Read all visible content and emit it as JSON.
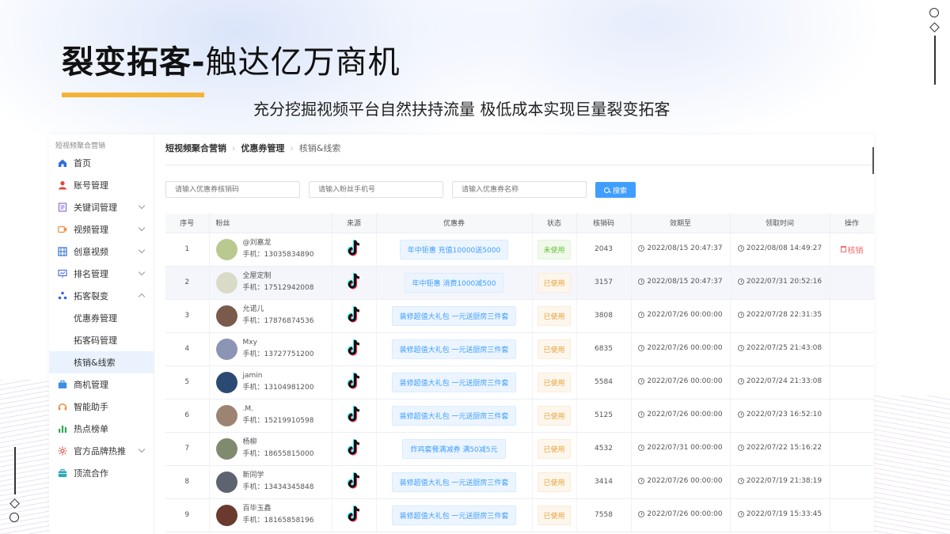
{
  "hero": {
    "title_bold": "裂变拓客-",
    "title_rest": "触达亿万商机",
    "subtitle": "充分挖掘视频平台自然扶持流量 极低成本实现巨量裂变拓客"
  },
  "sidebar": {
    "brand": "短视频聚合营销",
    "items": [
      {
        "label": "首页",
        "icon": "home-icon"
      },
      {
        "label": "账号管理",
        "icon": "user-icon"
      },
      {
        "label": "关键词管理",
        "icon": "keyword-icon"
      },
      {
        "label": "视频管理",
        "icon": "video-icon"
      },
      {
        "label": "创意视频",
        "icon": "film-icon"
      },
      {
        "label": "排名管理",
        "icon": "rank-icon"
      },
      {
        "label": "拓客裂变",
        "icon": "fission-icon"
      },
      {
        "label": "商机管理",
        "icon": "briefcase-icon"
      },
      {
        "label": "智能助手",
        "icon": "headset-icon"
      },
      {
        "label": "热点榜单",
        "icon": "bar-chart-icon"
      },
      {
        "label": "官方品牌热推",
        "icon": "brand-icon"
      },
      {
        "label": "顶流合作",
        "icon": "cooperation-icon"
      }
    ],
    "sub_items": [
      "优惠券管理",
      "拓客码管理",
      "核销&线索"
    ]
  },
  "breadcrumb": [
    "短视频聚合营销",
    "优惠券管理",
    "核销&线索"
  ],
  "filters": {
    "coupon_code_placeholder": "请输入优惠券核销码",
    "fan_phone_placeholder": "请输入粉丝手机号",
    "coupon_name_placeholder": "请输入优惠券名称",
    "search_label": "搜索"
  },
  "table": {
    "columns": [
      "序号",
      "粉丝",
      "来源",
      "优惠券",
      "状态",
      "核销码",
      "效期至",
      "领取时间",
      "操作"
    ],
    "action_label": "核销",
    "rows": [
      {
        "index": "1",
        "name": "@刘嘉龙",
        "phone": "手机：13035834890",
        "coupon": "年中钜惠 充值10000送5000",
        "status": "未使用",
        "code": "2043",
        "valid_until": "2022/08/15 20:47:37",
        "received": "2022/08/08 14:49:27",
        "avatar_color": "#b9c98f"
      },
      {
        "index": "2",
        "name": "全屋定制",
        "phone": "手机：17512942008",
        "coupon": "年中钜惠 消费1000减500",
        "status": "已使用",
        "code": "3157",
        "valid_until": "2022/08/15 20:47:37",
        "received": "2022/07/31 20:52:16",
        "avatar_color": "#d9dbc8"
      },
      {
        "index": "3",
        "name": "允诺儿",
        "phone": "手机：17876874536",
        "coupon": "装修超值大礼包 一元送厨房三件套",
        "status": "已使用",
        "code": "3808",
        "valid_until": "2022/07/26 00:00:00",
        "received": "2022/07/28 22:31:35",
        "avatar_color": "#7a5a4a"
      },
      {
        "index": "4",
        "name": "Mxy",
        "phone": "手机：13727751200",
        "coupon": "装修超值大礼包 一元送厨房三件套",
        "status": "已使用",
        "code": "6835",
        "valid_until": "2022/07/26 00:00:00",
        "received": "2022/07/25 21:43:08",
        "avatar_color": "#8c95b4"
      },
      {
        "index": "5",
        "name": "jamin",
        "phone": "手机：13104981200",
        "coupon": "装修超值大礼包 一元送厨房三件套",
        "status": "已使用",
        "code": "5584",
        "valid_until": "2022/07/26 00:00:00",
        "received": "2022/07/24 21:33:08",
        "avatar_color": "#2b4a73"
      },
      {
        "index": "6",
        "name": ".M.",
        "phone": "手机：15219910598",
        "coupon": "装修超值大礼包 一元送厨房三件套",
        "status": "已使用",
        "code": "5125",
        "valid_until": "2022/07/26 00:00:00",
        "received": "2022/07/23 16:52:10",
        "avatar_color": "#9b8472"
      },
      {
        "index": "7",
        "name": "杨柳",
        "phone": "手机：18655815000",
        "coupon": "炸鸡套餐满减券 满50减5元",
        "status": "已使用",
        "code": "4532",
        "valid_until": "2022/07/31 00:00:00",
        "received": "2022/07/22 15:16:22",
        "avatar_color": "#7f8a6f"
      },
      {
        "index": "8",
        "name": "新同学",
        "phone": "手机：13434345848",
        "coupon": "装修超值大礼包 一元送厨房三件套",
        "status": "已使用",
        "code": "3414",
        "valid_until": "2022/07/26 00:00:00",
        "received": "2022/07/19 21:38:19",
        "avatar_color": "#5d6470"
      },
      {
        "index": "9",
        "name": "百毕玉鑫",
        "phone": "手机：18165858196",
        "coupon": "装修超值大礼包 一元送厨房三件套",
        "status": "已使用",
        "code": "7558",
        "valid_until": "2022/07/26 00:00:00",
        "received": "2022/07/19 15:33:45",
        "avatar_color": "#6b3a2e"
      }
    ]
  },
  "colors": {
    "accent": "#409eff",
    "hero_bar": "#f5b335",
    "unused": "#67c23a",
    "used": "#e6a23c",
    "danger": "#f56c6c"
  }
}
